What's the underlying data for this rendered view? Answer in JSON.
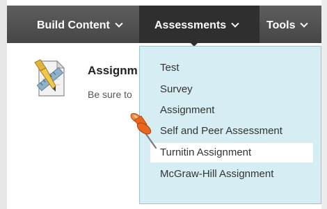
{
  "toolbar": {
    "build_content": "Build Content",
    "assessments": "Assessments",
    "tools": "Tools"
  },
  "content_item": {
    "title": "Assignm",
    "description": "Be sure to",
    "icon": "assignment-ruler-icon"
  },
  "dropdown": {
    "items": [
      {
        "label": "Test"
      },
      {
        "label": "Survey"
      },
      {
        "label": "Assignment"
      },
      {
        "label": "Self and Peer Assessment"
      },
      {
        "label": "Turnitin Assignment",
        "highlighted": true
      },
      {
        "label": "McGraw-Hill Assignment"
      }
    ]
  },
  "colors": {
    "toolbar": "#4f4f4f",
    "active_tab": "#2f2f2f",
    "dropdown_bg": "#d6eef3",
    "pin": "#e8661e"
  },
  "annotation_icon": "pushpin-icon"
}
